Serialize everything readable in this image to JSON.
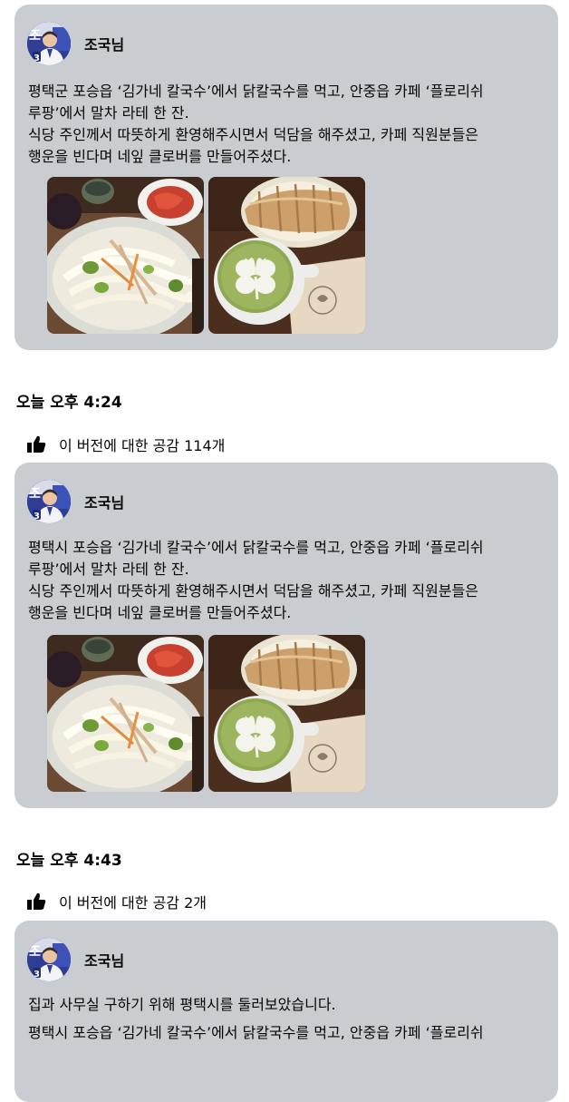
{
  "posts": [
    {
      "author": "조국님",
      "lines": [
        "평택군 포승읍 ‘김가네 칼국수’에서 닭칼국수를 먹고, 안중읍 카페 ‘플로리쉬",
        "루팡’에서 말차 라테 한 잔.",
        "식당 주인께서 따뜻하게 환영해주시면서 덕담을 해주셨고, 카페 직원분들은",
        "행운을 빈다며 네잎 클로버를 만들어주셨다."
      ]
    },
    {
      "author": "조국님",
      "lines": [
        "평택시 포승읍 ‘김가네 칼국수’에서 닭칼국수를 먹고, 안중읍 카페 ‘플로리쉬",
        "루팡’에서 말차 라테 한 잔.",
        "식당 주인께서 따뜻하게 환영해주시면서 덕담을 해주셨고, 카페 직원분들은",
        "행운을 빈다며 네잎 클로버를 만들어주셨다."
      ]
    },
    {
      "author": "조국님",
      "lines": [
        "집과 사무실 구하기 위해 평택시를 둘러보았습니다.",
        "평택시 포승읍 ‘김가네 칼국수’에서 닭칼국수를 먹고, 안중읍 카페 ‘플로리쉬"
      ]
    }
  ],
  "versions": [
    {
      "time": "오늘 오후 4:24",
      "reaction_text": "이 버전에 대한 공감 114개"
    },
    {
      "time": "오늘 오후 4:43",
      "reaction_text": "이 버전에 대한 공감 2개"
    }
  ],
  "icons": {
    "avatar": "profile-photo",
    "like": "thumbs-up-icon"
  },
  "colors": {
    "card_background": "#c9ccd1",
    "text": "#050505",
    "page_background": "#ffffff"
  }
}
